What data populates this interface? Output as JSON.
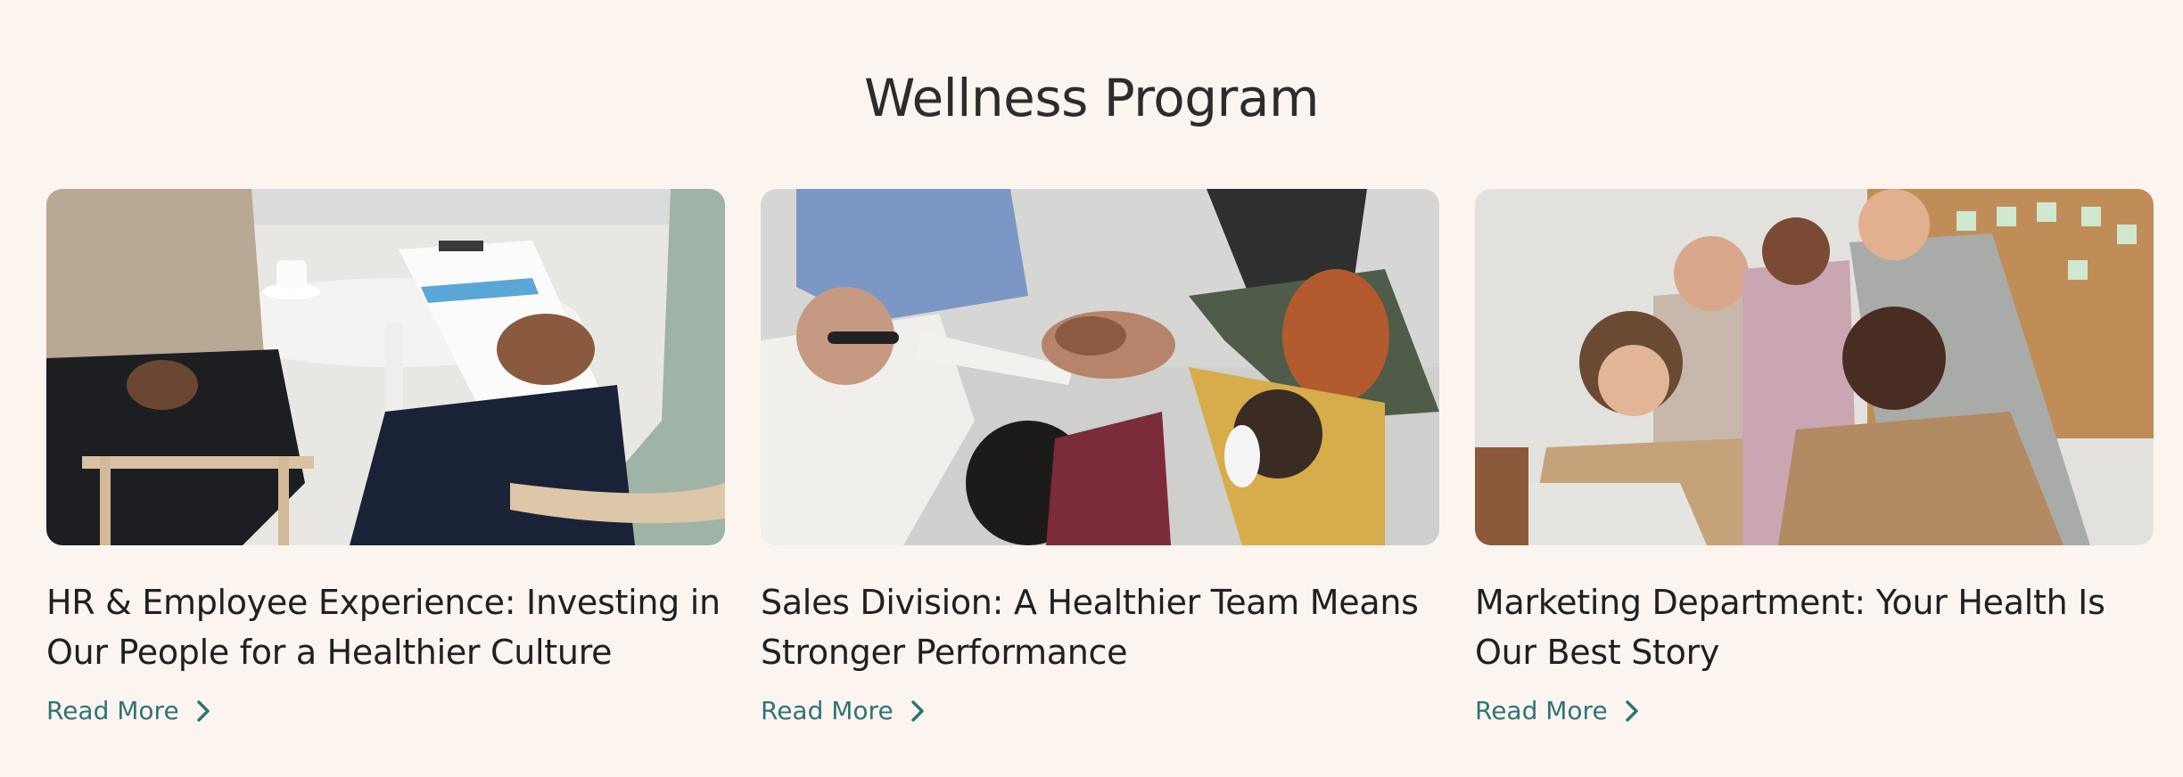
{
  "section": {
    "title": "Wellness Program"
  },
  "cards": [
    {
      "title": "HR & Employee Experience: Investing in Our People for a Healthier Culture",
      "read_more": "Read More",
      "image": "photo-hr-meeting-clipboard"
    },
    {
      "title": "Sales Division: A Healthier Team Means Stronger Performance",
      "read_more": "Read More",
      "image": "photo-team-hands-together"
    },
    {
      "title": "Marketing Department: Your Health Is Our Best Story",
      "read_more": "Read More",
      "image": "photo-team-laptop-smiling"
    }
  ],
  "colors": {
    "background": "#fcf5ef",
    "title": "#2f2b2a",
    "card_title": "#22201f",
    "link": "#2f7474"
  }
}
